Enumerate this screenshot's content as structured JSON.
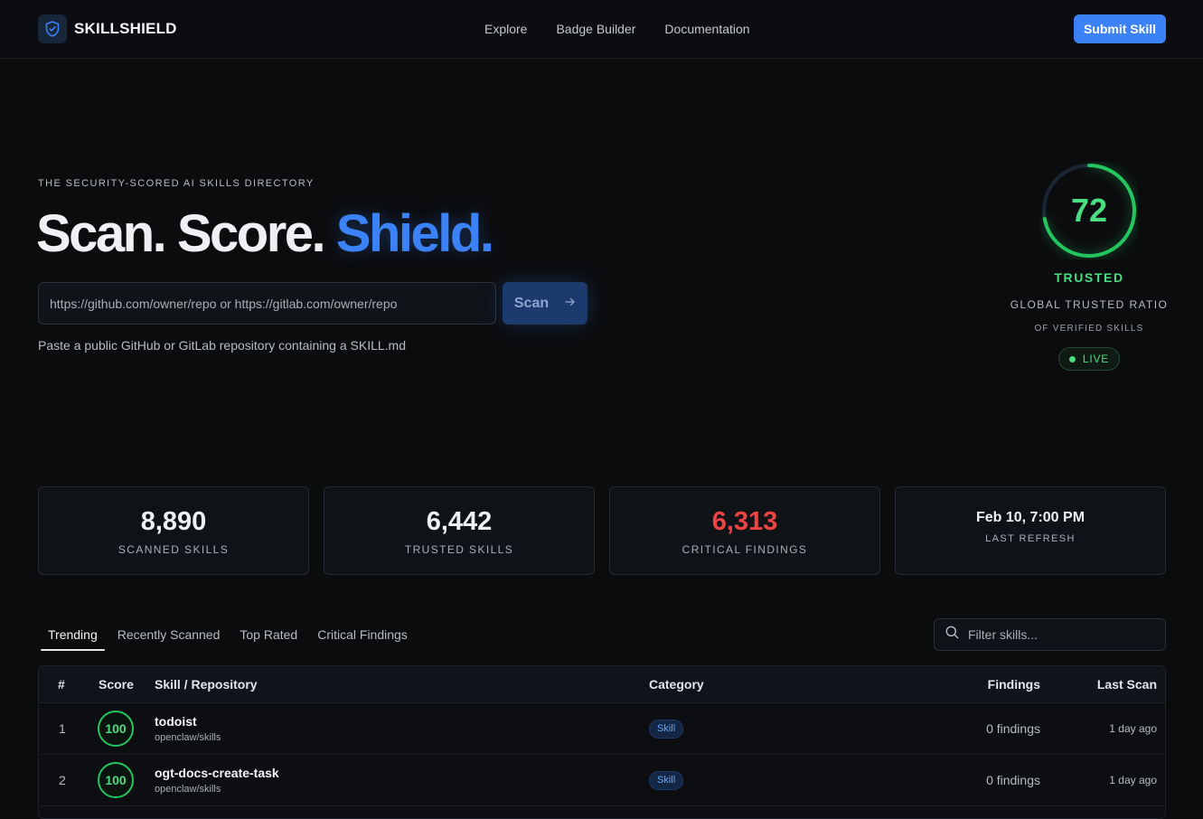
{
  "header": {
    "brand": "SKILLSHIELD",
    "nav": [
      "Explore",
      "Badge Builder",
      "Documentation"
    ],
    "submit_label": "Submit Skill"
  },
  "hero": {
    "eyebrow": "THE SECURITY-SCORED AI SKILLS DIRECTORY",
    "headline_part1": "Scan. Score. ",
    "headline_accent": "Shield.",
    "input_placeholder": "https://github.com/owner/repo or https://gitlab.com/owner/repo",
    "scan_label": "Scan",
    "hint": "Paste a public GitHub or GitLab repository containing a SKILL.md"
  },
  "trust": {
    "score": "72",
    "score_fraction": 0.72,
    "status": "TRUSTED",
    "ratio_label": "GLOBAL TRUSTED RATIO",
    "sub_label": "OF VERIFIED SKILLS",
    "live_label": "LIVE"
  },
  "stats": [
    {
      "value": "8,890",
      "label": "SCANNED SKILLS"
    },
    {
      "value": "6,442",
      "label": "TRUSTED SKILLS"
    },
    {
      "value": "6,313",
      "label": "CRITICAL FINDINGS"
    },
    {
      "value": "Feb 10, 7:00 PM",
      "label": "LAST REFRESH"
    }
  ],
  "tabs": [
    "Trending",
    "Recently Scanned",
    "Top Rated",
    "Critical Findings"
  ],
  "filter_placeholder": "Filter skills...",
  "table": {
    "columns": [
      "#",
      "Score",
      "Skill / Repository",
      "Category",
      "Findings",
      "Last Scan"
    ],
    "rows": [
      {
        "rank": "1",
        "score": "100",
        "name": "todoist",
        "repo": "openclaw/skills",
        "category": "Skill",
        "findings": "0 findings",
        "last_scan": "1 day ago"
      },
      {
        "rank": "2",
        "score": "100",
        "name": "ogt-docs-create-task",
        "repo": "openclaw/skills",
        "category": "Skill",
        "findings": "0 findings",
        "last_scan": "1 day ago"
      }
    ]
  },
  "colors": {
    "accent": "#3b82f6",
    "trusted": "#4ade80",
    "critical": "#ef4444",
    "background": "#0b0c0e"
  }
}
